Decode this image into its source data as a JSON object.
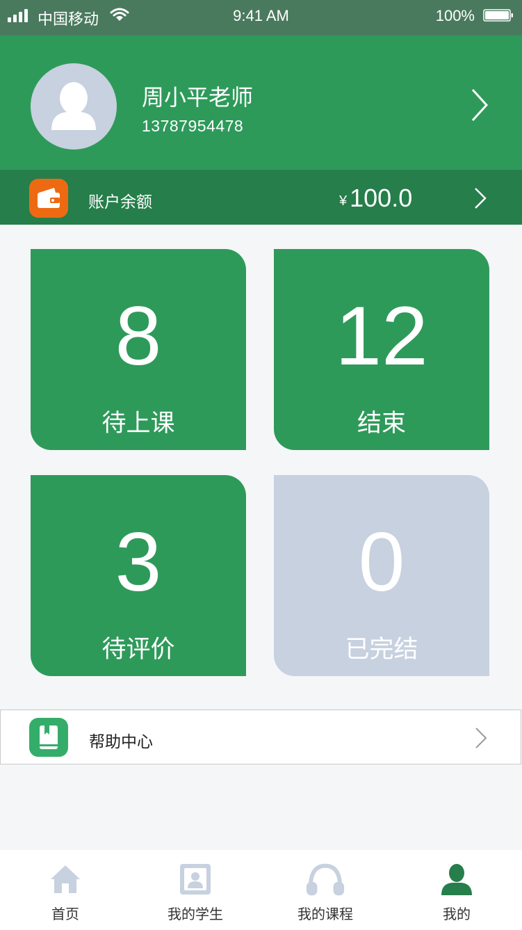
{
  "status_bar": {
    "carrier": "中国移动",
    "time": "9:41 AM",
    "battery": "100%"
  },
  "profile": {
    "name": "周小平老师",
    "phone": "13787954478"
  },
  "balance": {
    "label": "账户余额",
    "currency_symbol": "¥",
    "amount": "100.0"
  },
  "stats": [
    {
      "count": "8",
      "label": "待上课"
    },
    {
      "count": "12",
      "label": "结束"
    },
    {
      "count": "3",
      "label": "待评价"
    },
    {
      "count": "0",
      "label": "已完结"
    }
  ],
  "help": {
    "label": "帮助中心"
  },
  "tabs": [
    {
      "label": "首页",
      "icon": "home-icon",
      "active": false
    },
    {
      "label": "我的学生",
      "icon": "student-icon",
      "active": false
    },
    {
      "label": "我的课程",
      "icon": "headphones-icon",
      "active": false
    },
    {
      "label": "我的",
      "icon": "person-icon",
      "active": true
    }
  ],
  "colors": {
    "primary_green": "#2e9a5a",
    "dark_green": "#267e4a",
    "inactive_card": "#c7d1df",
    "wallet_orange": "#ee6a12",
    "help_green": "#35ad6a",
    "inactive_icon": "#c7d1df"
  }
}
